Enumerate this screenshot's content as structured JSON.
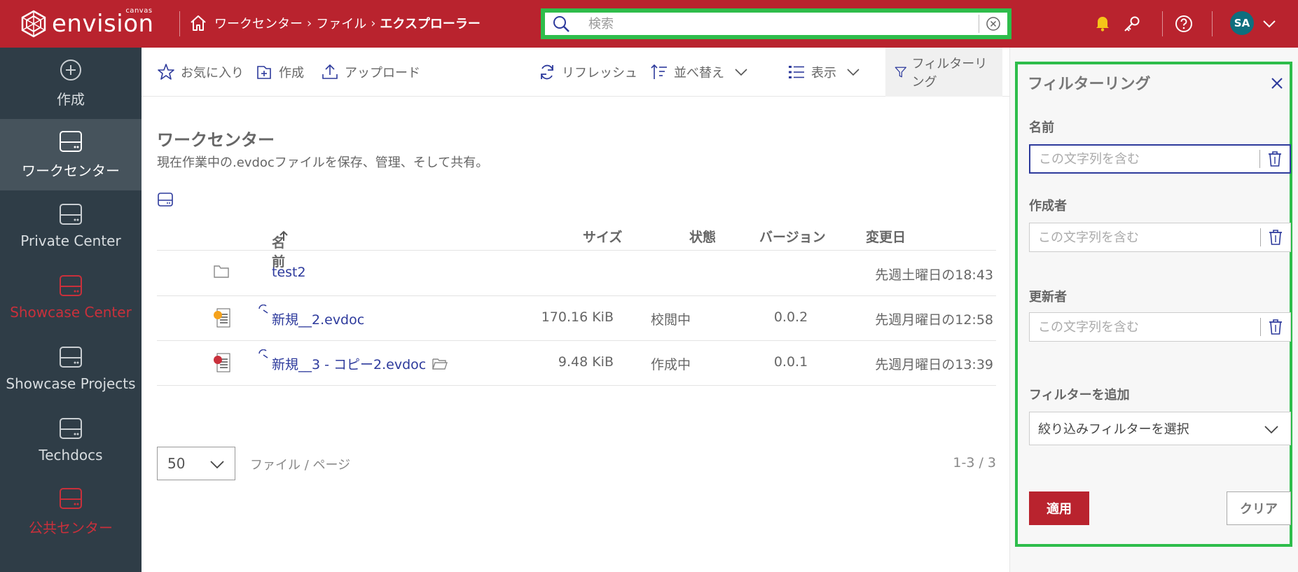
{
  "header": {
    "logo_text": "envision",
    "logo_sub": "canvas",
    "breadcrumb": [
      "ワークセンター",
      "ファイル",
      "エクスプローラー"
    ],
    "search_placeholder": "検索",
    "avatar_initials": "SA"
  },
  "sidebar": {
    "items": [
      {
        "label": "作成",
        "icon": "plus-circle-icon"
      },
      {
        "label": "ワークセンター",
        "icon": "drive-icon",
        "active": true
      },
      {
        "label": "Private Center",
        "icon": "drive-icon"
      },
      {
        "label": "Showcase Center",
        "icon": "drive-icon",
        "color": "red"
      },
      {
        "label": "Showcase Projects",
        "icon": "drive-icon"
      },
      {
        "label": "Techdocs",
        "icon": "drive-icon"
      },
      {
        "label": "公共センター",
        "icon": "drive-icon",
        "color": "red"
      }
    ]
  },
  "toolbar": {
    "favorite": "お気に入り",
    "create": "作成",
    "upload": "アップロード",
    "refresh": "リフレッシュ",
    "sort": "並べ替え",
    "view": "表示",
    "filter": "フィルターリング"
  },
  "main": {
    "title": "ワークセンター",
    "description": "現在作業中の.evdocファイルを保存、管理、そして共有。",
    "columns": {
      "name": "名前",
      "size": "サイズ",
      "state": "状態",
      "version": "バージョン",
      "modified": "変更日"
    },
    "rows": [
      {
        "name": "test2",
        "type": "folder",
        "size": "",
        "state": "",
        "version": "",
        "modified": "先週土曜日の18:43"
      },
      {
        "name": "新規__2.evdoc",
        "type": "evdoc-yellow",
        "size": "170.16 KiB",
        "state": "校閲中",
        "version": "0.0.2",
        "modified": "先週月曜日の12:58"
      },
      {
        "name": "新規__3 - コピー2.evdoc",
        "type": "evdoc-red",
        "size": "9.48 KiB",
        "state": "作成中",
        "version": "0.0.1",
        "modified": "先週月曜日の13:39"
      }
    ],
    "pager": {
      "per_page_value": "50",
      "per_page_label": "ファイル / ページ",
      "range": "1-3 / 3"
    }
  },
  "filter_panel": {
    "title": "フィルターリング",
    "name_label": "名前",
    "creator_label": "作成者",
    "updater_label": "更新者",
    "placeholder": "この文字列を含む",
    "add_filter_label": "フィルターを追加",
    "select_value": "絞り込みフィルターを選択",
    "apply": "適用",
    "clear": "クリア"
  },
  "colors": {
    "brand_red": "#b9232e",
    "sidebar_bg": "#2f3d47",
    "link_blue": "#2d3a9c",
    "highlight_green": "#2ebd4b"
  }
}
